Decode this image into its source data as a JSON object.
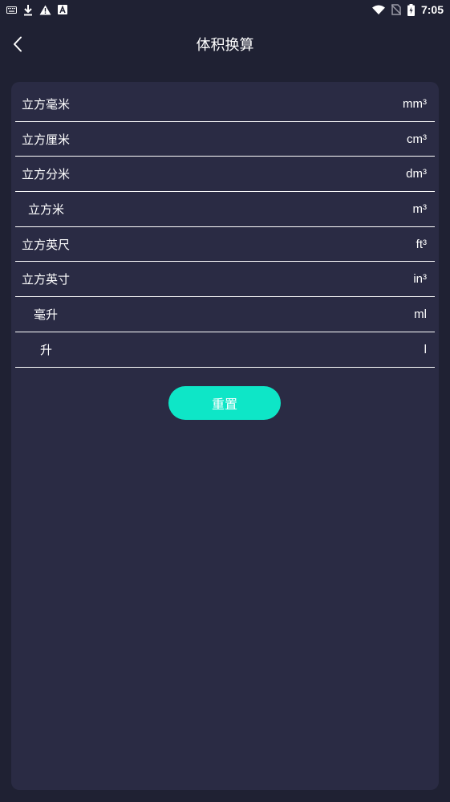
{
  "status_bar": {
    "time": "7:05",
    "left_icons": [
      "keyboard-icon",
      "download-icon",
      "warning-icon",
      "a-box-icon"
    ],
    "right_icons": [
      "wifi-icon",
      "no-sim-icon",
      "battery-icon"
    ]
  },
  "header": {
    "title": "体积换算",
    "back_icon": "chevron-left-icon"
  },
  "units": [
    {
      "name": "立方毫米",
      "symbol": "mm³"
    },
    {
      "name": "立方厘米",
      "symbol": "cm³"
    },
    {
      "name": "立方分米",
      "symbol": "dm³"
    },
    {
      "name": "立方米",
      "symbol": "m³"
    },
    {
      "name": "立方英尺",
      "symbol": "ft³"
    },
    {
      "name": "立方英寸",
      "symbol": "in³"
    },
    {
      "name": "毫升",
      "symbol": "ml"
    },
    {
      "name": "升",
      "symbol": "l"
    }
  ],
  "reset_label": "重置",
  "colors": {
    "background": "#1f2133",
    "card": "#2a2b44",
    "accent": "#0ee6c7",
    "text": "#ffffff"
  }
}
